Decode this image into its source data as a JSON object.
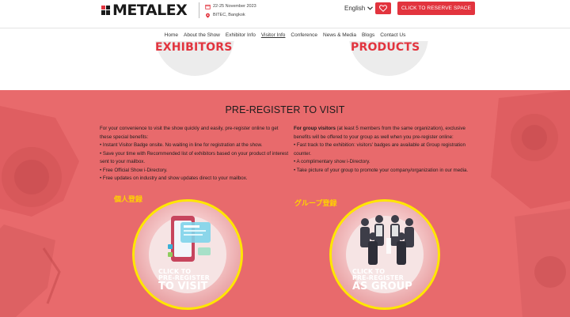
{
  "header": {
    "logo_text": "METALEX",
    "event_date": "22-25 November 2023",
    "event_location": "BITEC, Bangkok",
    "language": "English",
    "reserve_button": "CLICK TO RESERVE SPACE"
  },
  "nav": {
    "items": [
      "Home",
      "About the Show",
      "Exhibitor Info",
      "Visitor Info",
      "Conference",
      "News & Media",
      "Blogs",
      "Contact Us"
    ],
    "active": "Visitor Info"
  },
  "search_cards": {
    "left_label": "EXHIBITORS",
    "right_label": "PRODUCTS"
  },
  "preregister": {
    "title": "PRE-REGISTER TO VISIT",
    "individual": {
      "intro": "For your convenience to visit the show quickly and easily, pre-register online to get these special benefits:",
      "benefits": [
        "• Instant Visitor Badge onsite. No waiting in line for registration at the show.",
        "• Save your time with Recommended list of exhibitors based on your product of interest sent to your mailbox.",
        "• Free Official Show i-Directory.",
        "• Free updates on industry and show updates direct to your mailbox."
      ],
      "jp_label": "個人登録",
      "button_line1": "CLICK TO",
      "button_line2": "PRE-REGISTER",
      "button_line3": "TO VISIT"
    },
    "group": {
      "intro_bold": "For group visitors",
      "intro_rest": " (at least 5 members from the same organization), exclusive benefits will be offered to your group as well when you pre-register online:",
      "benefits": [
        "• Fast track to the exhibition: visitors' badges are available at Group registration counter.",
        "• A complimentary show i-Directory.",
        "• Take picture of your group to promote your company/organization in our media."
      ],
      "jp_label": "グループ登録",
      "button_line1": "CLICK TO",
      "button_line2": "PRE-REGISTER",
      "button_line3": "AS GROUP"
    }
  },
  "colors": {
    "brand_red": "#e2343e",
    "section_bg": "#e86a6c",
    "highlight_ring": "#ffe600",
    "jp_label": "#ffd200"
  }
}
